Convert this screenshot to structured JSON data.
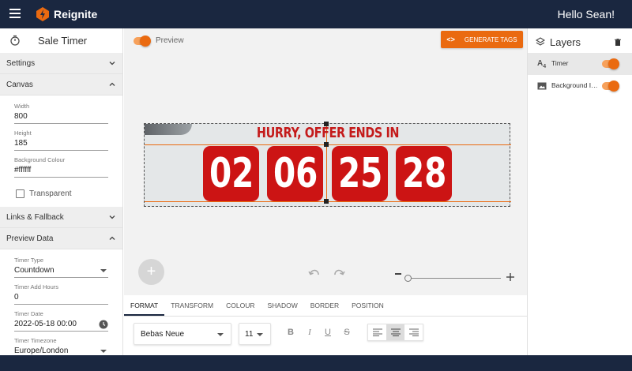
{
  "app": {
    "name": "Reignite",
    "greeting": "Hello Sean!"
  },
  "sidebar": {
    "title": "Sale Timer",
    "sections": {
      "settings": "Settings",
      "canvas": "Canvas",
      "links": "Links & Fallback",
      "preview_data": "Preview Data"
    },
    "canvas_fields": {
      "width_label": "Width",
      "width_value": "800",
      "height_label": "Height",
      "height_value": "185",
      "bg_label": "Background Colour",
      "bg_value": "#ffffff",
      "transparent_label": "Transparent"
    },
    "preview_fields": {
      "timer_type_label": "Timer Type",
      "timer_type_value": "Countdown",
      "add_hours_label": "Timer Add Hours",
      "add_hours_value": "0",
      "date_label": "Timer Date",
      "date_value": "2022-05-18 00:00",
      "timezone_label": "Timer Timezone",
      "timezone_value": "Europe/London"
    }
  },
  "center": {
    "preview_label": "Preview",
    "generate_button": "GENERATE TAGS",
    "code_glyph": "<>",
    "canvas": {
      "headline": "HURRY, OFFER ENDS IN",
      "digits": [
        "02",
        "06",
        "25",
        "28"
      ]
    },
    "add_glyph": "+",
    "tabs": [
      "FORMAT",
      "TRANSFORM",
      "COLOUR",
      "SHADOW",
      "BORDER",
      "POSITION"
    ],
    "font_value": "Bebas Neue",
    "size_value": "11",
    "format_buttons": {
      "bold": "B",
      "italic": "I",
      "underline": "U",
      "strike": "S"
    }
  },
  "layers": {
    "title": "Layers",
    "items": [
      {
        "name": "Timer",
        "icon_text": "A",
        "icon_sub": "4"
      },
      {
        "name": "Background Im..."
      }
    ]
  },
  "colors": {
    "accent": "#ea6a10",
    "navbar": "#1a2740",
    "digit_bg": "#cc1414",
    "headline": "#c41b1b"
  }
}
